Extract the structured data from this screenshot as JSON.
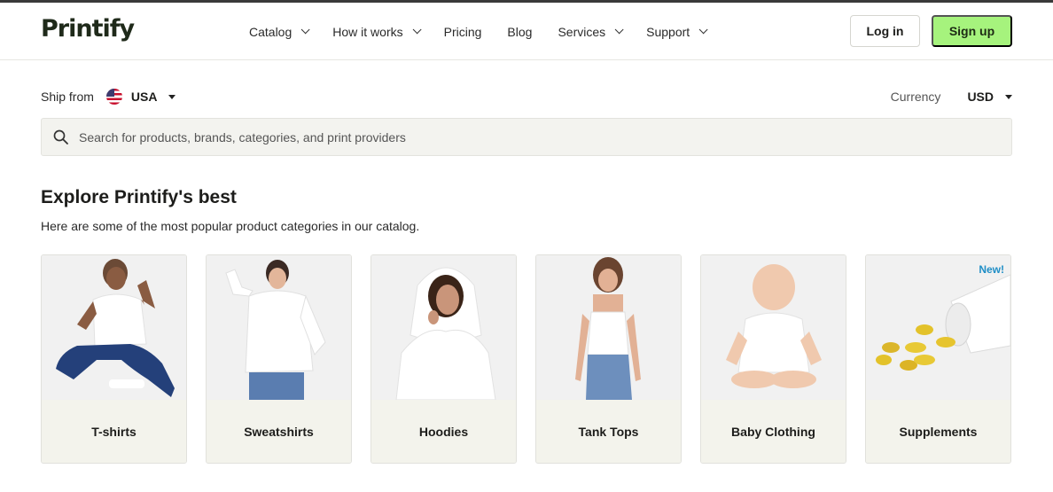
{
  "header": {
    "logo": "Printify",
    "nav": [
      {
        "label": "Catalog",
        "has_dropdown": true
      },
      {
        "label": "How it works",
        "has_dropdown": true
      },
      {
        "label": "Pricing",
        "has_dropdown": false
      },
      {
        "label": "Blog",
        "has_dropdown": false
      },
      {
        "label": "Services",
        "has_dropdown": true
      },
      {
        "label": "Support",
        "has_dropdown": true
      }
    ],
    "login_label": "Log in",
    "signup_label": "Sign up"
  },
  "ship": {
    "label": "Ship from",
    "country": "USA",
    "flag_icon": "us-flag-icon"
  },
  "currency": {
    "label": "Currency",
    "value": "USD"
  },
  "search": {
    "placeholder": "Search for products, brands, categories, and print providers"
  },
  "section": {
    "title": "Explore Printify's best",
    "subtitle": "Here are some of the most popular product categories in our catalog."
  },
  "categories": [
    {
      "label": "T-shirts",
      "badge": ""
    },
    {
      "label": "Sweatshirts",
      "badge": ""
    },
    {
      "label": "Hoodies",
      "badge": ""
    },
    {
      "label": "Tank Tops",
      "badge": ""
    },
    {
      "label": "Baby Clothing",
      "badge": ""
    },
    {
      "label": "Supplements",
      "badge": "New!"
    }
  ],
  "colors": {
    "signup_bg": "#a6f37d",
    "badge": "#1f8ec6",
    "card_label_bg": "#f3f3ec"
  }
}
